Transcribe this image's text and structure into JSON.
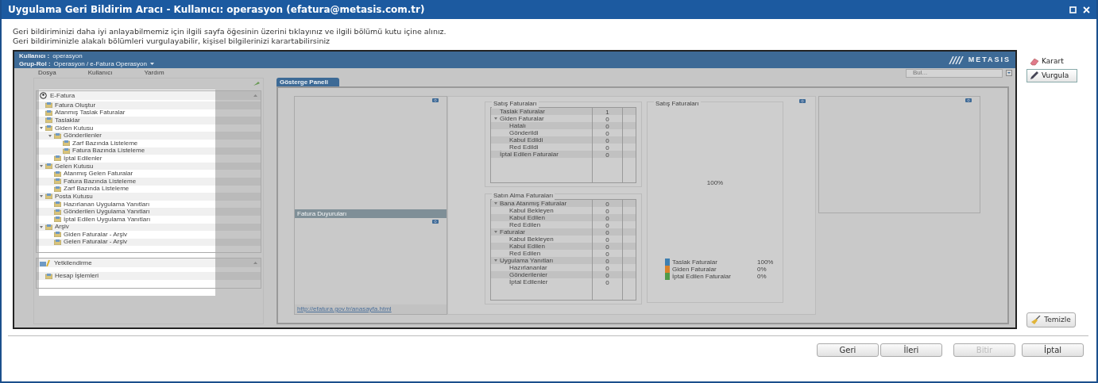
{
  "window": {
    "title": "Uygulama Geri Bildirim Aracı - Kullanıcı: operasyon (efatura@metasis.com.tr)"
  },
  "instructions": [
    "Geri bildiriminizi daha iyi anlayabilmemiz için ilgili sayfa öğesinin üzerini tıklayınız ve ilgili bölümü kutu içine alınız.",
    "Geri bildiriminizle alakalı bölümleri vurgulayabilir,  kişisel bilgilerinizi karartabilirsiniz"
  ],
  "capture": {
    "user_line": {
      "label": "Kullanıcı :",
      "value": "operasyon"
    },
    "role_line": {
      "label": "Grup-Rol :",
      "value": "Operasyon / e-Fatura Operasyon"
    },
    "logo": "METASIS",
    "menus": [
      "Dosya",
      "Kullanıcı",
      "Yardım"
    ],
    "search": {
      "placeholder": "Bul..."
    },
    "nav_highlighted": true,
    "panels": [
      {
        "title": "E-Fatura",
        "items": [
          {
            "label": "Fatura Oluştur"
          },
          {
            "label": "Atanmış Taslak Faturalar"
          },
          {
            "label": "Taslaklar"
          },
          {
            "label": "Giden Kutusu",
            "expanded": true,
            "children": [
              {
                "label": "Gönderilenler",
                "expanded": true,
                "children": [
                  {
                    "label": "Zarf Bazında Listeleme"
                  },
                  {
                    "label": "Fatura Bazında Listeleme"
                  }
                ]
              },
              {
                "label": "İptal Edilenler"
              }
            ]
          },
          {
            "label": "Gelen Kutusu",
            "expanded": true,
            "children": [
              {
                "label": "Atanmış Gelen Faturalar"
              },
              {
                "label": "Fatura Bazında Listeleme"
              },
              {
                "label": "Zarf Bazında Listeleme"
              }
            ]
          },
          {
            "label": "Posta Kutusu",
            "expanded": true,
            "children": [
              {
                "label": "Hazırlanan Uygulama Yanıtları"
              },
              {
                "label": "Gönderilen Uygulama Yanıtları"
              },
              {
                "label": "İptal Edilen Uygulama Yanıtları"
              }
            ]
          },
          {
            "label": "Arşiv",
            "expanded": true,
            "children": [
              {
                "label": "Giden Faturalar - Arşiv"
              },
              {
                "label": "Gelen Faturalar - Arşiv"
              }
            ]
          }
        ]
      },
      {
        "title": "Yetkilendirme",
        "items": [
          {
            "label": "Hesap İşlemleri"
          }
        ]
      }
    ],
    "tabs": [
      {
        "label": "Gösterge Paneli",
        "selected": true
      }
    ],
    "announcements": {
      "title": "Fatura Duyuruları",
      "link": "http://efatura.gov.tr/anasayfa.html"
    },
    "tables": [
      {
        "title": "Satış Faturaları",
        "rows": [
          {
            "label": "Taslak Faturalar",
            "value": "1"
          },
          {
            "label": "Giden Faturalar",
            "value": "0",
            "expanded": true,
            "children": [
              {
                "label": "Hatalı",
                "value": "0"
              },
              {
                "label": "Gönderildi",
                "value": "0"
              },
              {
                "label": "Kabul Edildi",
                "value": "0"
              },
              {
                "label": "Red Edildi",
                "value": "0"
              }
            ]
          },
          {
            "label": "İptal Edilen Faturalar",
            "value": "0"
          }
        ]
      },
      {
        "title": "Satın Alma Faturaları",
        "rows": [
          {
            "label": "Bana Atanmış Faturalar",
            "value": "0",
            "expanded": true,
            "children": [
              {
                "label": "Kabul Bekleyen",
                "value": "0"
              },
              {
                "label": "Kabul Edilen",
                "value": "0"
              },
              {
                "label": "Red Edilen",
                "value": "0"
              }
            ]
          },
          {
            "label": "Faturalar",
            "value": "0",
            "expanded": true,
            "children": [
              {
                "label": "Kabul Bekleyen",
                "value": "0"
              },
              {
                "label": "Kabul Edilen",
                "value": "0"
              },
              {
                "label": "Red Edilen",
                "value": "0"
              }
            ]
          },
          {
            "label": "Uygulama Yanıtları",
            "value": "0",
            "expanded": true,
            "children": [
              {
                "label": "Hazırlananlar",
                "value": "0"
              },
              {
                "label": "Gönderilenler",
                "value": "0"
              },
              {
                "label": "İptal Edilenler",
                "value": "0"
              }
            ]
          }
        ]
      }
    ],
    "pie": {
      "title": "Satış Faturaları",
      "center_label": "100%",
      "legend": [
        {
          "label": "Taslak Faturalar",
          "value": "100%",
          "color": "#3f7fb0"
        },
        {
          "label": "Giden Faturalar",
          "value": "0%",
          "color": "#d9822b"
        },
        {
          "label": "İptal Edilen Faturalar",
          "value": "0%",
          "color": "#4f9a48"
        }
      ]
    }
  },
  "tools": [
    {
      "kind": "eraser",
      "label": "Karart",
      "selected": false
    },
    {
      "kind": "pencil",
      "label": "Vurgula",
      "selected": true
    }
  ],
  "clear_button": "Temizle",
  "buttons": [
    {
      "label": "Geri",
      "disabled": false
    },
    {
      "label": "İleri",
      "disabled": false
    },
    {
      "label": "Bitir",
      "disabled": true
    },
    {
      "label": "İptal",
      "disabled": false
    }
  ]
}
